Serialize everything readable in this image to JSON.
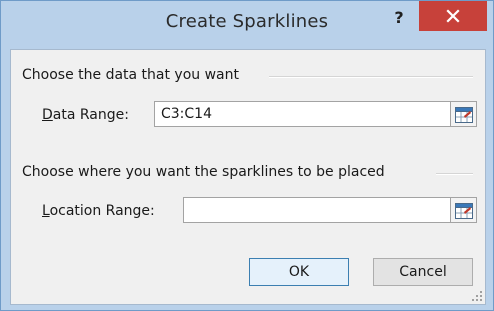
{
  "window": {
    "title": "Create Sparklines",
    "help_label": "?"
  },
  "data_group": {
    "heading": "Choose the data that you want",
    "field": {
      "label_mnemonic": "D",
      "label_rest": "ata Range:",
      "value": "C3:C14"
    }
  },
  "location_group": {
    "heading": "Choose where you want the sparklines to be placed",
    "field": {
      "label_mnemonic": "L",
      "label_rest": "ocation Range:",
      "value": ""
    }
  },
  "buttons": {
    "ok_label": "OK",
    "cancel_label": "Cancel"
  },
  "colors": {
    "frame": "#b9d1ea",
    "close": "#c7413a",
    "client": "#f0f0f0",
    "default_button_border": "#3c7fb1"
  },
  "icons": {
    "close": "close-icon",
    "range_picker": "range-collapse-icon",
    "resize": "resize-grip-icon"
  }
}
